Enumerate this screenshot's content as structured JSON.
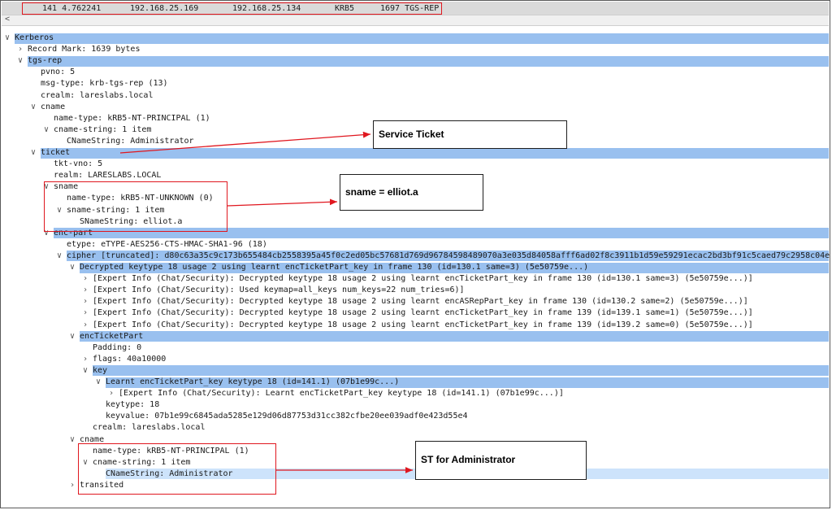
{
  "packet_row": {
    "no_time": "141 4.762241",
    "source": "192.168.25.169",
    "destination": "192.168.25.134",
    "protocol": "KRB5",
    "length_info": "1697 TGS-REP"
  },
  "tree_lines": [
    {
      "text": "Kerberos",
      "twisty": "open"
    },
    {
      "text": "Record Mark: 1639 bytes",
      "twisty": "closed"
    },
    {
      "text": "tgs-rep",
      "twisty": "open"
    },
    {
      "text": "pvno: 5",
      "twisty": ""
    },
    {
      "text": "msg-type: krb-tgs-rep (13)",
      "twisty": ""
    },
    {
      "text": "crealm: lareslabs.local",
      "twisty": ""
    },
    {
      "text": "cname",
      "twisty": "open"
    },
    {
      "text": "name-type: kRB5-NT-PRINCIPAL (1)",
      "twisty": ""
    },
    {
      "text": "cname-string: 1 item",
      "twisty": "open"
    },
    {
      "text": "CNameString: Administrator",
      "twisty": ""
    },
    {
      "text": "ticket",
      "twisty": "open"
    },
    {
      "text": "tkt-vno: 5",
      "twisty": ""
    },
    {
      "text": "realm: LARESLABS.LOCAL",
      "twisty": ""
    },
    {
      "text": "sname",
      "twisty": "open"
    },
    {
      "text": "name-type: kRB5-NT-UNKNOWN (0)",
      "twisty": ""
    },
    {
      "text": "sname-string: 1 item",
      "twisty": "open"
    },
    {
      "text": "SNameString: elliot.a",
      "twisty": ""
    },
    {
      "text": "enc-part",
      "twisty": "open"
    },
    {
      "text": "etype: eTYPE-AES256-CTS-HMAC-SHA1-96 (18)",
      "twisty": ""
    },
    {
      "text": "cipher [truncated]: d80c63a35c9c173b655484cb2558395a45f0c2ed05bc57681d769d96784598489070a3e035d84058afff6ad02f8c3911b1d59e59291ecac2bd3bf91c5caed79c2958c04e",
      "twisty": "open"
    },
    {
      "text": "Decrypted keytype 18 usage 2 using learnt encTicketPart_key in frame 130 (id=130.1 same=3) (5e50759e...)",
      "twisty": "open"
    },
    {
      "text": "[Expert Info (Chat/Security): Decrypted keytype 18 usage 2 using learnt encTicketPart_key in frame 130 (id=130.1 same=3) (5e50759e...)]",
      "twisty": "closed"
    },
    {
      "text": "[Expert Info (Chat/Security): Used keymap=all_keys num_keys=22 num_tries=6)]",
      "twisty": "closed"
    },
    {
      "text": "[Expert Info (Chat/Security): Decrypted keytype 18 usage 2 using learnt encASRepPart_key in frame 130 (id=130.2 same=2) (5e50759e...)]",
      "twisty": "closed"
    },
    {
      "text": "[Expert Info (Chat/Security): Decrypted keytype 18 usage 2 using learnt encTicketPart_key in frame 139 (id=139.1 same=1) (5e50759e...)]",
      "twisty": "closed"
    },
    {
      "text": "[Expert Info (Chat/Security): Decrypted keytype 18 usage 2 using learnt encTicketPart_key in frame 139 (id=139.2 same=0) (5e50759e...)]",
      "twisty": "closed"
    },
    {
      "text": "encTicketPart",
      "twisty": "open"
    },
    {
      "text": "Padding: 0",
      "twisty": ""
    },
    {
      "text": "flags: 40a10000",
      "twisty": "closed"
    },
    {
      "text": "key",
      "twisty": "open"
    },
    {
      "text": "Learnt encTicketPart_key keytype 18 (id=141.1) (07b1e99c...)",
      "twisty": "open"
    },
    {
      "text": "[Expert Info (Chat/Security): Learnt encTicketPart_key keytype 18 (id=141.1) (07b1e99c...)]",
      "twisty": "closed"
    },
    {
      "text": "keytype: 18",
      "twisty": ""
    },
    {
      "text": "keyvalue: 07b1e99c6845ada5285e129d06d87753d31cc382cfbe20ee039adf0e423d55e4",
      "twisty": ""
    },
    {
      "text": "crealm: lareslabs.local",
      "twisty": ""
    },
    {
      "text": "cname",
      "twisty": "open"
    },
    {
      "text": "name-type: kRB5-NT-PRINCIPAL (1)",
      "twisty": ""
    },
    {
      "text": "cname-string: 1 item",
      "twisty": "open"
    },
    {
      "text": "CNameString: Administrator",
      "twisty": ""
    },
    {
      "text": "transited",
      "twisty": "closed"
    }
  ],
  "annotations": {
    "service_ticket": "Service Ticket",
    "sname_label": "sname = elliot.a",
    "st_admin": "ST for Administrator"
  },
  "colors": {
    "highlight": "#99c0ef",
    "current_selection": "#cde3fb",
    "red_box": "#e0171f"
  }
}
